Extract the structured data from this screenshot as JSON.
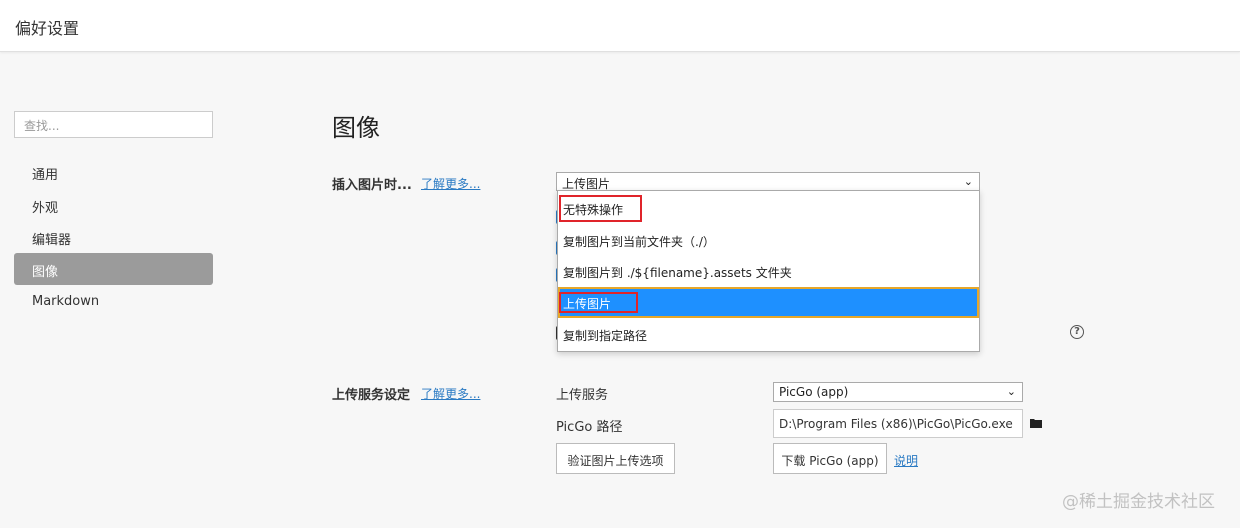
{
  "window": {
    "title": "偏好设置"
  },
  "sidebar": {
    "search_placeholder": "查找...",
    "items": [
      {
        "label": "通用",
        "active": false
      },
      {
        "label": "外观",
        "active": false
      },
      {
        "label": "编辑器",
        "active": false
      },
      {
        "label": "图像",
        "active": true
      },
      {
        "label": "Markdown",
        "active": false
      }
    ]
  },
  "main": {
    "section_title": "图像",
    "insert_image": {
      "label": "插入图片时...",
      "learn_more": "了解更多...",
      "selected_value": "上传图片",
      "options": [
        {
          "label": "无特殊操作",
          "highlighted_box": true,
          "selected": false
        },
        {
          "label": "复制图片到当前文件夹（./）",
          "highlighted_box": false,
          "selected": false
        },
        {
          "label": "复制图片到 ./${filename}.assets 文件夹",
          "highlighted_box": false,
          "selected": false
        },
        {
          "label": "上传图片",
          "highlighted_box": true,
          "selected": true
        },
        {
          "label": "复制到指定路径",
          "highlighted_box": false,
          "selected": false
        }
      ]
    },
    "upload_service": {
      "label": "上传服务设定",
      "learn_more": "了解更多...",
      "service_label": "上传服务",
      "service_value": "PicGo (app)",
      "path_label": "PicGo 路径",
      "path_value": "D:\\Program Files (x86)\\PicGo\\PicGo.exe",
      "verify_button": "验证图片上传选项",
      "download_button": "下载 PicGo (app)",
      "help_link": "说明"
    }
  },
  "watermark": "@稀土掘金技术社区",
  "colors": {
    "accent": "#1e90ff",
    "link": "#2a7ac3",
    "highlight_box": "#e0242a",
    "active_nav": "#9b9b9b"
  }
}
